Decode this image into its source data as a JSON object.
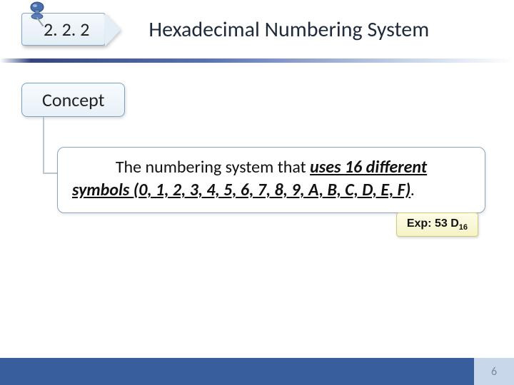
{
  "header": {
    "section_number": "2. 2. 2",
    "title": "Hexadecimal Numbering System"
  },
  "concept": {
    "label": "Concept",
    "definition_lead": "The numbering system that ",
    "definition_bold1": "uses 16 different",
    "definition_line2_bold": "symbols ",
    "definition_symbols": "(0, 1, 2, 3, 4, 5, 6, 7, 8, 9, A, B, C, D, E, F)",
    "definition_period": "."
  },
  "example": {
    "prefix": "Exp: ",
    "value": "53 D",
    "subscript": "16"
  },
  "footer": {
    "page_number": "6"
  },
  "colors": {
    "footer_primary": "#385e9d",
    "footer_accent": "#c9d7ea"
  }
}
